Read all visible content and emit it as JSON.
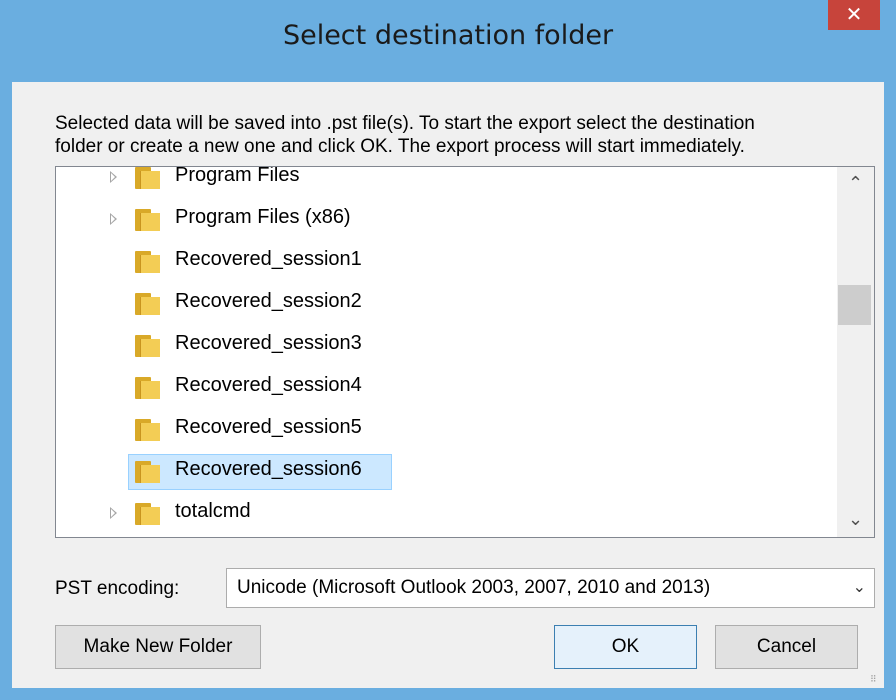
{
  "window": {
    "title": "Select destination folder",
    "close_glyph": "✕"
  },
  "description": {
    "line1": "Selected data will be saved into .pst file(s). To start the export select the destination",
    "line2": "folder or create a new one and click OK. The export process will start immediately."
  },
  "tree": {
    "items": [
      {
        "label": "Program Files",
        "expandable": true,
        "selected": false
      },
      {
        "label": "Program Files (x86)",
        "expandable": true,
        "selected": false
      },
      {
        "label": "Recovered_session1",
        "expandable": false,
        "selected": false
      },
      {
        "label": "Recovered_session2",
        "expandable": false,
        "selected": false
      },
      {
        "label": "Recovered_session3",
        "expandable": false,
        "selected": false
      },
      {
        "label": "Recovered_session4",
        "expandable": false,
        "selected": false
      },
      {
        "label": "Recovered_session5",
        "expandable": false,
        "selected": false
      },
      {
        "label": "Recovered_session6",
        "expandable": false,
        "selected": true
      },
      {
        "label": "totalcmd",
        "expandable": true,
        "selected": false
      }
    ],
    "scroll_up_glyph": "⌃",
    "scroll_down_glyph": "⌄"
  },
  "encoding": {
    "label": "PST encoding:",
    "value": "Unicode (Microsoft Outlook 2003, 2007, 2010 and 2013)",
    "chevron_glyph": "⌄"
  },
  "buttons": {
    "make_new_folder": "Make New Folder",
    "ok": "OK",
    "cancel": "Cancel"
  },
  "colors": {
    "frame": "#6aaee0",
    "close": "#c7443b",
    "selection": "#cce8ff"
  }
}
